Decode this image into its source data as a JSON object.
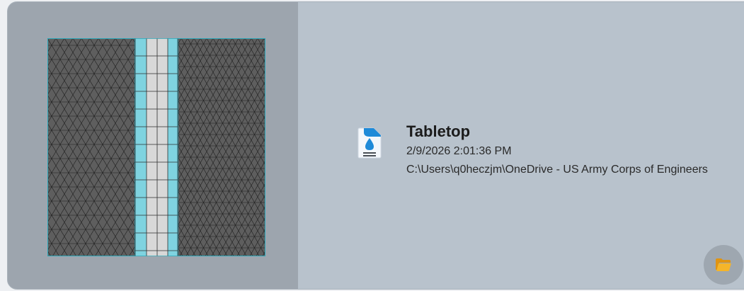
{
  "recent_item": {
    "title": "Tabletop",
    "date": "2/9/2026 2:01:36 PM",
    "path": "C:\\Users\\q0heczjm\\OneDrive - US Army Corps of Engineers",
    "icon": "water-document-icon",
    "thumbnail_icon": "mesh-thumbnail"
  },
  "actions": {
    "open_folder_icon": "folder-open-icon"
  },
  "colors": {
    "card_bg": "#b8c2cc",
    "thumb_panel_bg": "#9da5ae",
    "mesh_dark": "#5c5c5c",
    "mesh_cyan": "#7fd3e0",
    "mesh_light": "#d8d8d8",
    "accent_blue": "#1f8ad8",
    "folder_orange": "#f2a81d"
  }
}
